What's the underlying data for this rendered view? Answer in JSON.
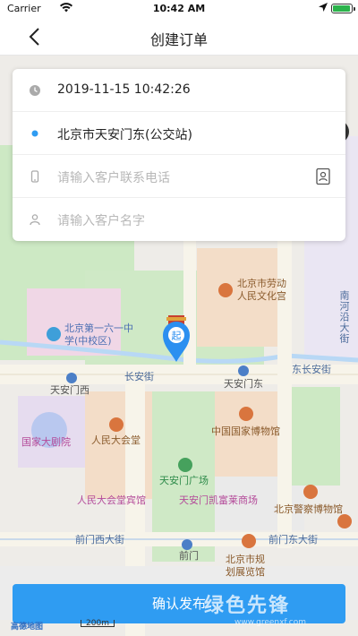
{
  "status_bar": {
    "carrier": "Carrier",
    "time": "10:42 AM"
  },
  "nav": {
    "title": "创建订单",
    "back_icon": "chevron-left-icon"
  },
  "order": {
    "datetime": "2019-11-15 10:42:26",
    "location": "北京市天安门东(公交站)",
    "phone_placeholder": "请输入客户联系电话",
    "name_placeholder": "请输入客户名字"
  },
  "map": {
    "pois": {
      "labor_palace": "北京市劳动\n人民文化宫",
      "school": "北京第一六一中\n学(中校区)",
      "tiananmen_west": "天安门西",
      "tiananmen_east": "天安门东",
      "chang_an": "长安街",
      "east_chang_an": "东长安街",
      "great_hall": "人民大会堂",
      "national_theatre": "国家大剧院",
      "national_museum": "中国国家博物馆",
      "square": "天安门广场",
      "great_hall_hotel": "人民大会堂宾馆",
      "kempinski": "天安门凯富莱商场",
      "police_museum": "北京警察博物馆",
      "qianmen_west": "前门西大街",
      "qianmen_east": "前门东大街",
      "qianmen": "前门",
      "planning_hall": "北京市规\n划展览馆",
      "nanheyan": "南河沿大街",
      "marker_label": "起"
    },
    "logo": "高德地图",
    "scale": "200m"
  },
  "confirm_label": "确认发布",
  "watermark": {
    "main": "绿色先锋",
    "sub": "www.greenxf.com"
  },
  "colors": {
    "accent": "#2f9cf2",
    "marker": "#2b8ff0",
    "primary_dot": "#2f9cf2"
  }
}
